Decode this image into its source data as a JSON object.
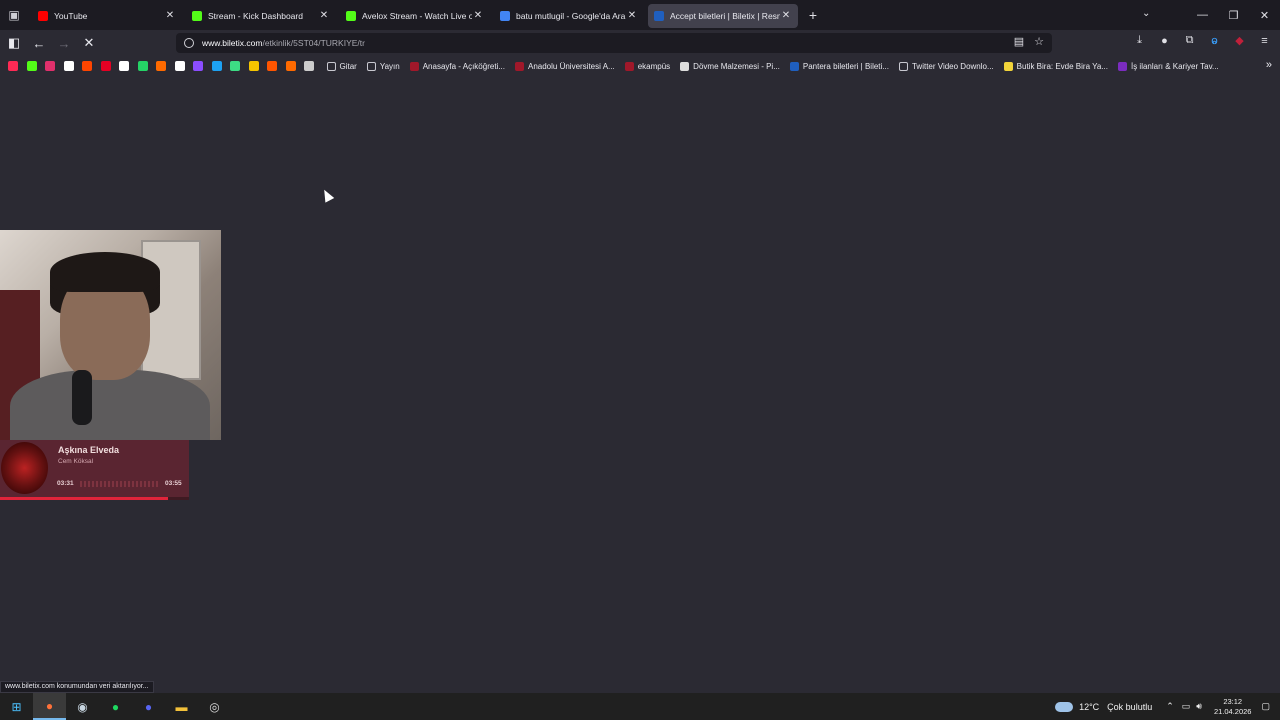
{
  "tabs": [
    {
      "title": "YouTube",
      "icon": "youtube-icon",
      "color": "#ff0000",
      "active": false
    },
    {
      "title": "Stream - Kick Dashboard",
      "icon": "kick-icon",
      "color": "#53fc18",
      "active": false
    },
    {
      "title": "Avelox Stream - Watch Live on Ki",
      "icon": "kick-icon",
      "color": "#53fc18",
      "active": false
    },
    {
      "title": "batu mutlugil - Google'da Ara",
      "icon": "google-icon",
      "color": "#4285f4",
      "active": false
    },
    {
      "title": "Accept biletleri | Biletix | Resmi B",
      "icon": "biletix-icon",
      "color": "#1f5fbf",
      "active": true
    }
  ],
  "newtab_label": "+",
  "url": {
    "host": "www.biletix.com",
    "path": "/etkinlik/5ST04/TURKIYE/tr"
  },
  "bookmarks": [
    {
      "label": "Gitar",
      "icon": "folder-icon"
    },
    {
      "label": "Yayın",
      "icon": "folder-icon"
    },
    {
      "label": "Anasayfa - Açıköğreti...",
      "icon": "anadolu-icon"
    },
    {
      "label": "Anadolu Üniversitesi A...",
      "icon": "anadolu-icon"
    },
    {
      "label": "ekampüs",
      "icon": "anadolu-icon"
    },
    {
      "label": "Dövme Malzemesi - Pi...",
      "icon": "tattoo-icon"
    },
    {
      "label": "Pantera biletleri | Bileti...",
      "icon": "biletix-icon"
    },
    {
      "label": "Twitter Video Downlo...",
      "icon": "globe-icon"
    },
    {
      "label": "Butik Bira: Evde Bira Ya...",
      "icon": "beer-icon"
    },
    {
      "label": "İş ilanları & Kariyer Tav...",
      "icon": "kariyer-icon"
    }
  ],
  "bookmark_icon_colors": [
    "#ff2a55",
    "#53fc18",
    "#e1306c",
    "#ffffff",
    "#ff4500",
    "#e60023",
    "#ffffff",
    "#25d366",
    "#ff6a00",
    "#ffffff",
    "#8c4dff",
    "#1da1f2",
    "#3ddc84",
    "#f5c400",
    "#ff5500",
    "#ff6a00",
    "#cccccc"
  ],
  "player": {
    "song": "Aşkına Elveda",
    "artist": "Cem Köksal",
    "elapsed": "03:31",
    "duration": "03:55",
    "progress": 0.89
  },
  "status_text": "www.biletix.com konumundan veri aktarılıyor...",
  "taskbar": {
    "apps": [
      "windows-start-icon",
      "firefox-icon",
      "steam-icon",
      "spotify-icon",
      "discord-icon",
      "file-explorer-icon",
      "obs-icon"
    ],
    "weather_temp": "12°C",
    "weather_desc": "Çok bulutlu",
    "time": "23:12",
    "date": "21.04.2026"
  }
}
